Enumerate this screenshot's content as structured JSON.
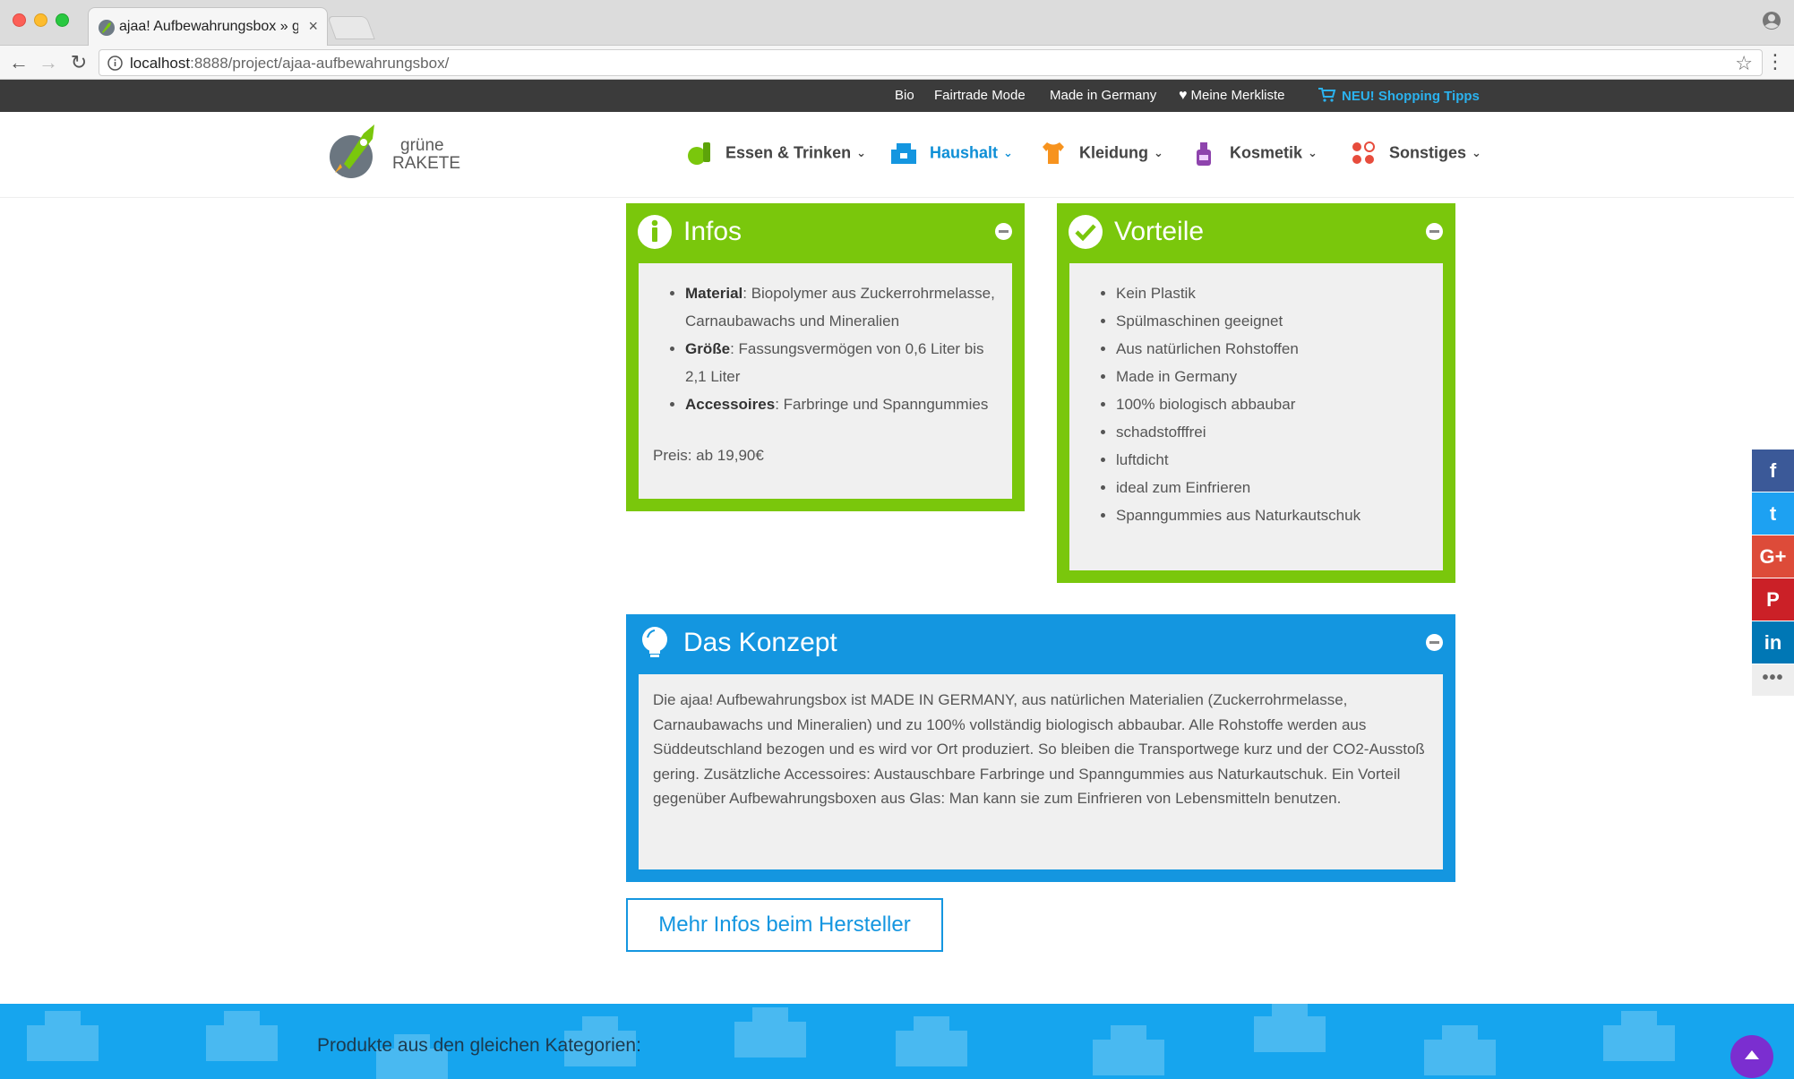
{
  "browser": {
    "tab_title": "ajaa! Aufbewahrungsbox » grü",
    "tab_close": "×",
    "url_host": "localhost",
    "url_rest": ":8888/project/ajaa-aufbewahrungsbox/"
  },
  "topbar": {
    "links": [
      "Bio",
      "Fairtrade Mode",
      "Made in Germany",
      "Meine Merkliste",
      "NEU! Shopping Tipps"
    ]
  },
  "logo": {
    "line1": "grüne",
    "line2": "RAKETE"
  },
  "nav": {
    "items": [
      {
        "label": "Essen & Trinken",
        "icon": "apple-icon"
      },
      {
        "label": "Haushalt",
        "icon": "house-icon",
        "active": true
      },
      {
        "label": "Kleidung",
        "icon": "shirt-icon"
      },
      {
        "label": "Kosmetik",
        "icon": "lotion-icon"
      },
      {
        "label": "Sonstiges",
        "icon": "dots-icon"
      }
    ]
  },
  "infos": {
    "title": "Infos",
    "items": [
      {
        "key": "Material",
        "text": ": Biopolymer aus Zuckerrohrmelasse, Carnaubawachs und Mineralien"
      },
      {
        "key": "Größe",
        "text": ": Fassungsvermögen von 0,6 Liter bis 2,1 Liter"
      },
      {
        "key": "Accessoires",
        "text": ": Farbringe und Spanngummies"
      }
    ],
    "price": "Preis: ab 19,90€"
  },
  "vorteile": {
    "title": "Vorteile",
    "items": [
      "Kein Plastik",
      "Spülmaschinen geeignet",
      "Aus natürlichen Rohstoffen",
      "Made in Germany",
      "100% biologisch abbaubar",
      "schadstofffrei",
      "luftdicht",
      "ideal zum Einfrieren",
      "Spanngummies aus Naturkautschuk"
    ]
  },
  "konzept": {
    "title": "Das Konzept",
    "text": "Die ajaa! Aufbewahrungsbox ist MADE IN GERMANY, aus natürlichen Materialien (Zuckerrohrmelasse, Carnaubawachs und Mineralien) und zu 100% vollständig biologisch abbaubar. Alle Rohstoffe werden aus Süddeutschland bezogen und es wird vor Ort produziert. So bleiben die Transportwege kurz und der CO2-Ausstoß gering. Zusätzliche Accessoires: Austauschbare Farbringe und Spanngummies aus Naturkautschuk. Ein Vorteil gegenüber Aufbewahrungsboxen aus Glas: Man kann sie zum Einfrieren von Lebensmitteln benutzen."
  },
  "cta": {
    "label": "Mehr Infos beim Hersteller"
  },
  "footer_band": {
    "title": "Produkte aus den gleichen Kategorien:"
  },
  "social": {
    "items": [
      {
        "name": "facebook-icon",
        "glyph": "f"
      },
      {
        "name": "twitter-icon",
        "glyph": "t"
      },
      {
        "name": "google-plus-icon",
        "glyph": "G+"
      },
      {
        "name": "pinterest-icon",
        "glyph": "P"
      },
      {
        "name": "linkedin-icon",
        "glyph": "in"
      },
      {
        "name": "more-icon",
        "glyph": "•••"
      }
    ]
  },
  "colors": {
    "green": "#7ac70c",
    "blue": "#1496e0",
    "topbar": "#3b3b3b",
    "band": "#16a5ee"
  }
}
